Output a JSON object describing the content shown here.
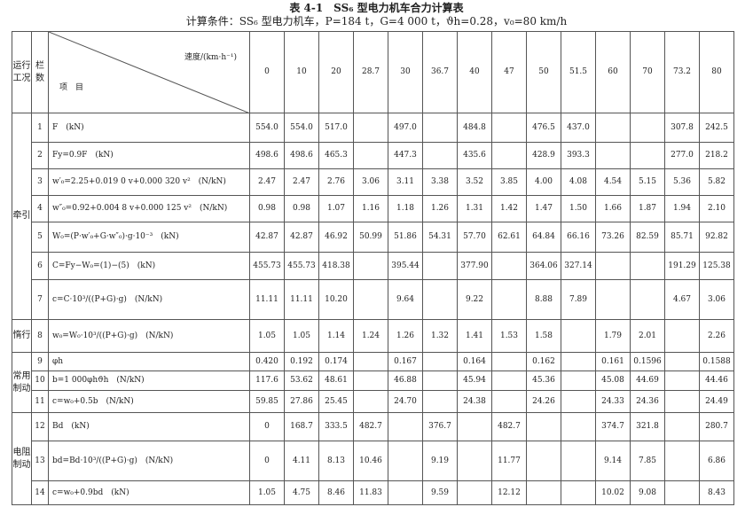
{
  "title": "表 4-1　SS₆ 型电力机车合力计算表",
  "subtitle": "计算条件：SS₆ 型电力机车，P=184 t，G=4 000 t，ϑh=0.28，v₀=80 km/h",
  "header": {
    "condition": "运行工况",
    "column": "栏数",
    "speed": "速度/(km·h⁻¹)",
    "item": "项　目",
    "speeds": [
      "0",
      "10",
      "20",
      "28.7",
      "30",
      "36.7",
      "40",
      "47",
      "50",
      "51.5",
      "60",
      "70",
      "73.2",
      "80"
    ]
  },
  "groups": {
    "traction": "牵引",
    "coasting": "惰行",
    "braking": "常用制动",
    "resistance": "电阻制动"
  },
  "rows": [
    {
      "no": "1",
      "item": "F　(kN)",
      "values": [
        "554.0",
        "554.0",
        "517.0",
        "",
        "497.0",
        "",
        "484.8",
        "",
        "476.5",
        "437.0",
        "",
        "",
        "307.8",
        "242.5"
      ]
    },
    {
      "no": "2",
      "item": "Fy=0.9F　(kN)",
      "values": [
        "498.6",
        "498.6",
        "465.3",
        "",
        "447.3",
        "",
        "435.6",
        "",
        "428.9",
        "393.3",
        "",
        "",
        "277.0",
        "218.2"
      ]
    },
    {
      "no": "3",
      "item": "w′₀=2.25+0.019 0 v+0.000 320 v²　(N/kN)",
      "values": [
        "2.47",
        "2.47",
        "2.76",
        "3.06",
        "3.11",
        "3.38",
        "3.52",
        "3.85",
        "4.00",
        "4.08",
        "4.54",
        "5.15",
        "5.36",
        "5.82"
      ]
    },
    {
      "no": "4",
      "item": "w″₀=0.92+0.004 8 v+0.000 125 v²　(N/kN)",
      "values": [
        "0.98",
        "0.98",
        "1.07",
        "1.16",
        "1.18",
        "1.26",
        "1.31",
        "1.42",
        "1.47",
        "1.50",
        "1.66",
        "1.87",
        "1.94",
        "2.10"
      ]
    },
    {
      "no": "5",
      "item": "W₀=(P·w′₀+G·w″₀)·g·10⁻³　(kN)",
      "values": [
        "42.87",
        "42.87",
        "46.92",
        "50.99",
        "51.86",
        "54.31",
        "57.70",
        "62.61",
        "64.84",
        "66.16",
        "73.26",
        "82.59",
        "85.71",
        "92.82"
      ]
    },
    {
      "no": "6",
      "item": "C=Fy−W₀=(1)−(5)　(kN)",
      "values": [
        "455.73",
        "455.73",
        "418.38",
        "",
        "395.44",
        "",
        "377.90",
        "",
        "364.06",
        "327.14",
        "",
        "",
        "191.29",
        "125.38"
      ]
    },
    {
      "no": "7",
      "item": "c=C·10³/((P+G)·g)　(N/kN)",
      "values": [
        "11.11",
        "11.11",
        "10.20",
        "",
        "9.64",
        "",
        "9.22",
        "",
        "8.88",
        "7.89",
        "",
        "",
        "4.67",
        "3.06"
      ]
    },
    {
      "no": "8",
      "item": "w₀=W₀·10³/((P+G)·g)　(N/kN)",
      "values": [
        "1.05",
        "1.05",
        "1.14",
        "1.24",
        "1.26",
        "1.32",
        "1.41",
        "1.53",
        "1.58",
        "",
        "1.79",
        "2.01",
        "",
        "2.26"
      ]
    },
    {
      "no": "9",
      "item": "φh",
      "values": [
        "0.420",
        "0.192",
        "0.174",
        "",
        "0.167",
        "",
        "0.164",
        "",
        "0.162",
        "",
        "0.161",
        "0.1596",
        "",
        "0.1588"
      ]
    },
    {
      "no": "10",
      "item": "b=1 000φhϑh　(N/kN)",
      "values": [
        "117.6",
        "53.62",
        "48.61",
        "",
        "46.88",
        "",
        "45.94",
        "",
        "45.36",
        "",
        "45.08",
        "44.69",
        "",
        "44.46"
      ]
    },
    {
      "no": "11",
      "item": "c=w₀+0.5b　(N/kN)",
      "values": [
        "59.85",
        "27.86",
        "25.45",
        "",
        "24.70",
        "",
        "24.38",
        "",
        "24.26",
        "",
        "24.33",
        "24.36",
        "",
        "24.49"
      ]
    },
    {
      "no": "12",
      "item": "Bd　(kN)",
      "values": [
        "0",
        "168.7",
        "333.5",
        "482.7",
        "",
        "376.7",
        "",
        "482.7",
        "",
        "",
        "374.7",
        "321.8",
        "",
        "280.7"
      ]
    },
    {
      "no": "13",
      "item": "bd=Bd·10³/((P+G)·g)　(N/kN)",
      "values": [
        "0",
        "4.11",
        "8.13",
        "10.46",
        "",
        "9.19",
        "",
        "11.77",
        "",
        "",
        "9.14",
        "7.85",
        "",
        "6.86"
      ]
    },
    {
      "no": "14",
      "item": "c=w₀+0.9bd　(kN)",
      "values": [
        "1.05",
        "4.75",
        "8.46",
        "11.83",
        "",
        "9.59",
        "",
        "12.12",
        "",
        "",
        "10.02",
        "9.08",
        "",
        "8.43"
      ]
    }
  ]
}
